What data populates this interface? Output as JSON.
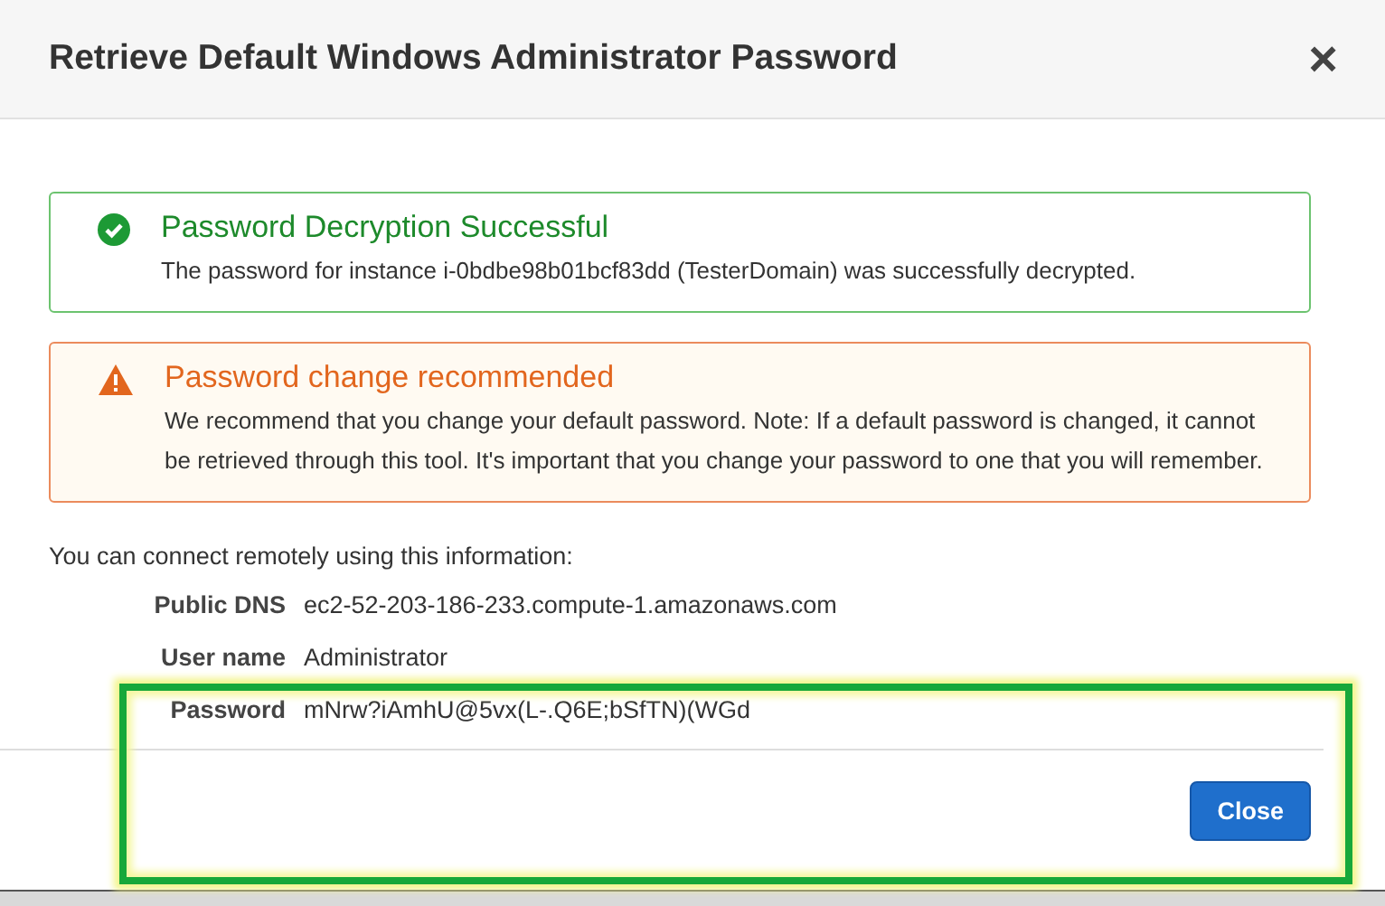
{
  "dialog": {
    "title": "Retrieve Default Windows Administrator Password",
    "close_symbol": "×"
  },
  "alerts": [
    {
      "kind": "success",
      "title": "Password Decryption Successful",
      "message": "The password for instance i-0bdbe98b01bcf83dd (TesterDomain) was successfully decrypted."
    },
    {
      "kind": "warning",
      "title": "Password change recommended",
      "message": "We recommend that you change your default password. Note: If a default password is changed, it cannot be retrieved through this tool. It's important that you change your password to one that you will remember."
    }
  ],
  "intro": "You can connect remotely using this information:",
  "details": [
    {
      "label": "Public DNS",
      "value": "ec2-52-203-186-233.compute-1.amazonaws.com"
    },
    {
      "label": "User name",
      "value": "Administrator"
    },
    {
      "label": "Password",
      "value": "mNrw?iAmhU@5vx(L-.Q6E;bSfTN)(WGd"
    }
  ],
  "annotation": {
    "highlight": true
  },
  "buttons": [
    "Close"
  ]
}
